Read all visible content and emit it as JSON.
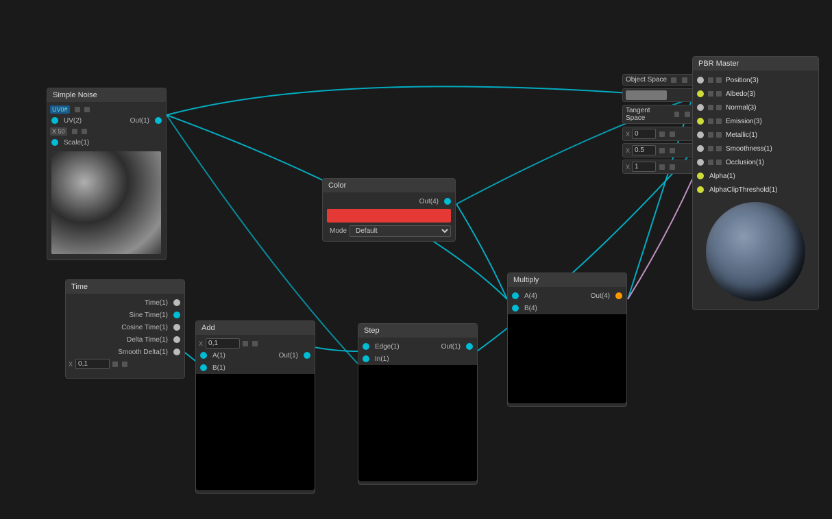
{
  "nodes": {
    "simpleNoise": {
      "title": "Simple Noise",
      "uv_label": "UV(2)",
      "out_label": "Out(1)",
      "scale_label": "Scale(1)",
      "uv_tag": "UV0#"
    },
    "time": {
      "title": "Time",
      "outputs": [
        "Time(1)",
        "Sine Time(1)",
        "Cosine Time(1)",
        "Delta Time(1)",
        "Smooth Delta(1)"
      ],
      "x_value": "0,1"
    },
    "add": {
      "title": "Add",
      "a_label": "A(1)",
      "b_label": "B(1)",
      "out_label": "Out(1)"
    },
    "step": {
      "title": "Step",
      "edge_label": "Edge(1)",
      "in_label": "In(1)",
      "out_label": "Out(1)"
    },
    "color": {
      "title": "Color",
      "out_label": "Out(4)",
      "mode_label": "Mode",
      "mode_value": "Default"
    },
    "multiply": {
      "title": "Multiply",
      "a_label": "A(4)",
      "b_label": "B(4)",
      "out_label": "Out(4)"
    },
    "pbrMaster": {
      "title": "PBR Master",
      "inputs": [
        "Position(3)",
        "Albedo(3)",
        "Normal(3)",
        "Emission(3)",
        "Metallic(1)",
        "Smoothness(1)",
        "Occlusion(1)",
        "Alpha(1)",
        "AlphaClipThreshold(1)"
      ]
    },
    "objectSpace": {
      "label": "Object Space"
    },
    "tangentSpace": {
      "label": "Tangent Space"
    },
    "metallic_x": "0",
    "smoothness_x": "0.5",
    "occlusion_x": "1"
  },
  "colors": {
    "bg": "#1a1a1a",
    "nodeHeader": "#3a3a3a",
    "nodeBody": "#2d2d2d",
    "cyan": "#00bcd4",
    "yellow": "#cddc39",
    "pink": "#e91e63",
    "red": "#e53935",
    "white": "#bbbbbb",
    "orange": "#ff9800"
  }
}
